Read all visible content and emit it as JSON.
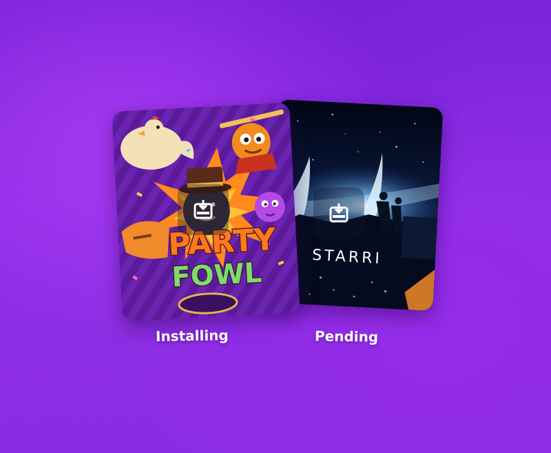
{
  "games": [
    {
      "title": "PARTY FOWL",
      "title_line1": "PARTY",
      "title_line2": "FOWL",
      "status": "Installing",
      "download_icon": "download-icon"
    },
    {
      "title": "STARRI",
      "status": "Pending",
      "download_icon": "download-icon"
    }
  ],
  "colors": {
    "background": "#8a2de2",
    "party_bg": "#5b1a9a",
    "party_stripe": "#6a24b0",
    "party_burst": "#ff8a1e",
    "party_title_orange": "#ff7a1a",
    "party_title_green": "#7fdc6a",
    "starri_bg": "#0a1430",
    "starri_glow": "#4aa8ff",
    "label_text": "#ffffff"
  }
}
